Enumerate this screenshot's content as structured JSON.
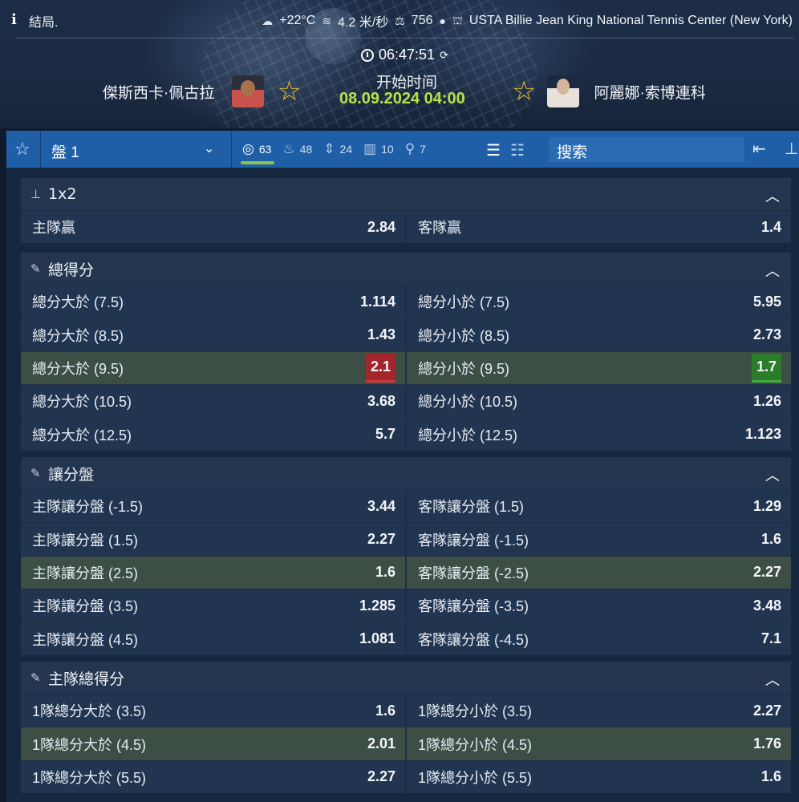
{
  "header": {
    "status": "結局.",
    "weather": {
      "temperature": "+22°C",
      "wind": "4.2 米/秒",
      "pressure": "756",
      "venue": "USTA Billie Jean King National Tennis Center (New York)"
    },
    "clock": "06:47:51",
    "start_label": "开始时间",
    "start_time": "08.09.2024 04:00",
    "home_player": "傑斯西卡·佩古拉",
    "away_player": "阿麗娜·索博連科"
  },
  "toolbar": {
    "set_select": "盤 1",
    "counts": [
      {
        "icon": "target-icon",
        "value": "63",
        "active": true
      },
      {
        "icon": "flame-icon",
        "value": "48",
        "active": false
      },
      {
        "icon": "updown-arrows-icon",
        "value": "24",
        "active": false
      },
      {
        "icon": "bars-chart-icon",
        "value": "10",
        "active": false
      },
      {
        "icon": "racket-icon",
        "value": "7",
        "active": false
      }
    ],
    "search_placeholder": "搜索"
  },
  "markets": [
    {
      "title": "1x2",
      "rows": [
        {
          "left": {
            "label": "主隊贏",
            "odds": "2.84"
          },
          "right": {
            "label": "客隊贏",
            "odds": "1.4"
          }
        }
      ]
    },
    {
      "title": "總得分",
      "rows": [
        {
          "left": {
            "label": "總分大於 (7.5)",
            "odds": "1.114"
          },
          "right": {
            "label": "總分小於 (7.5)",
            "odds": "5.95"
          }
        },
        {
          "left": {
            "label": "總分大於 (8.5)",
            "odds": "1.43"
          },
          "right": {
            "label": "總分小於 (8.5)",
            "odds": "2.73"
          }
        },
        {
          "left": {
            "label": "總分大於 (9.5)",
            "odds": "2.1",
            "trend": "down"
          },
          "right": {
            "label": "總分小於 (9.5)",
            "odds": "1.7",
            "trend": "up"
          },
          "highlight": true
        },
        {
          "left": {
            "label": "總分大於 (10.5)",
            "odds": "3.68"
          },
          "right": {
            "label": "總分小於 (10.5)",
            "odds": "1.26"
          }
        },
        {
          "left": {
            "label": "總分大於 (12.5)",
            "odds": "5.7"
          },
          "right": {
            "label": "總分小於 (12.5)",
            "odds": "1.123"
          }
        }
      ]
    },
    {
      "title": "讓分盤",
      "rows": [
        {
          "left": {
            "label": "主隊讓分盤 (-1.5)",
            "odds": "3.44"
          },
          "right": {
            "label": "客隊讓分盤 (1.5)",
            "odds": "1.29"
          }
        },
        {
          "left": {
            "label": "主隊讓分盤 (1.5)",
            "odds": "2.27"
          },
          "right": {
            "label": "客隊讓分盤 (-1.5)",
            "odds": "1.6"
          }
        },
        {
          "left": {
            "label": "主隊讓分盤 (2.5)",
            "odds": "1.6"
          },
          "right": {
            "label": "客隊讓分盤 (-2.5)",
            "odds": "2.27"
          },
          "highlight": true
        },
        {
          "left": {
            "label": "主隊讓分盤 (3.5)",
            "odds": "1.285"
          },
          "right": {
            "label": "客隊讓分盤 (-3.5)",
            "odds": "3.48"
          }
        },
        {
          "left": {
            "label": "主隊讓分盤 (4.5)",
            "odds": "1.081"
          },
          "right": {
            "label": "客隊讓分盤 (-4.5)",
            "odds": "7.1"
          }
        }
      ]
    },
    {
      "title": "主隊總得分",
      "rows": [
        {
          "left": {
            "label": "1隊總分大於 (3.5)",
            "odds": "1.6"
          },
          "right": {
            "label": "1隊總分小於 (3.5)",
            "odds": "2.27"
          }
        },
        {
          "left": {
            "label": "1隊總分大於 (4.5)",
            "odds": "2.01"
          },
          "right": {
            "label": "1隊總分小於 (4.5)",
            "odds": "1.76"
          },
          "highlight": true
        },
        {
          "left": {
            "label": "1隊總分大於 (5.5)",
            "odds": "2.27"
          },
          "right": {
            "label": "1隊總分小於 (5.5)",
            "odds": "1.6"
          }
        }
      ]
    }
  ],
  "colors": {
    "accent_blue": "#1e5fa8",
    "start_time_green": "#b9e346",
    "odds_down": "#a3262b",
    "odds_up": "#2b7d2b",
    "favorite_star": "#f2c230"
  }
}
